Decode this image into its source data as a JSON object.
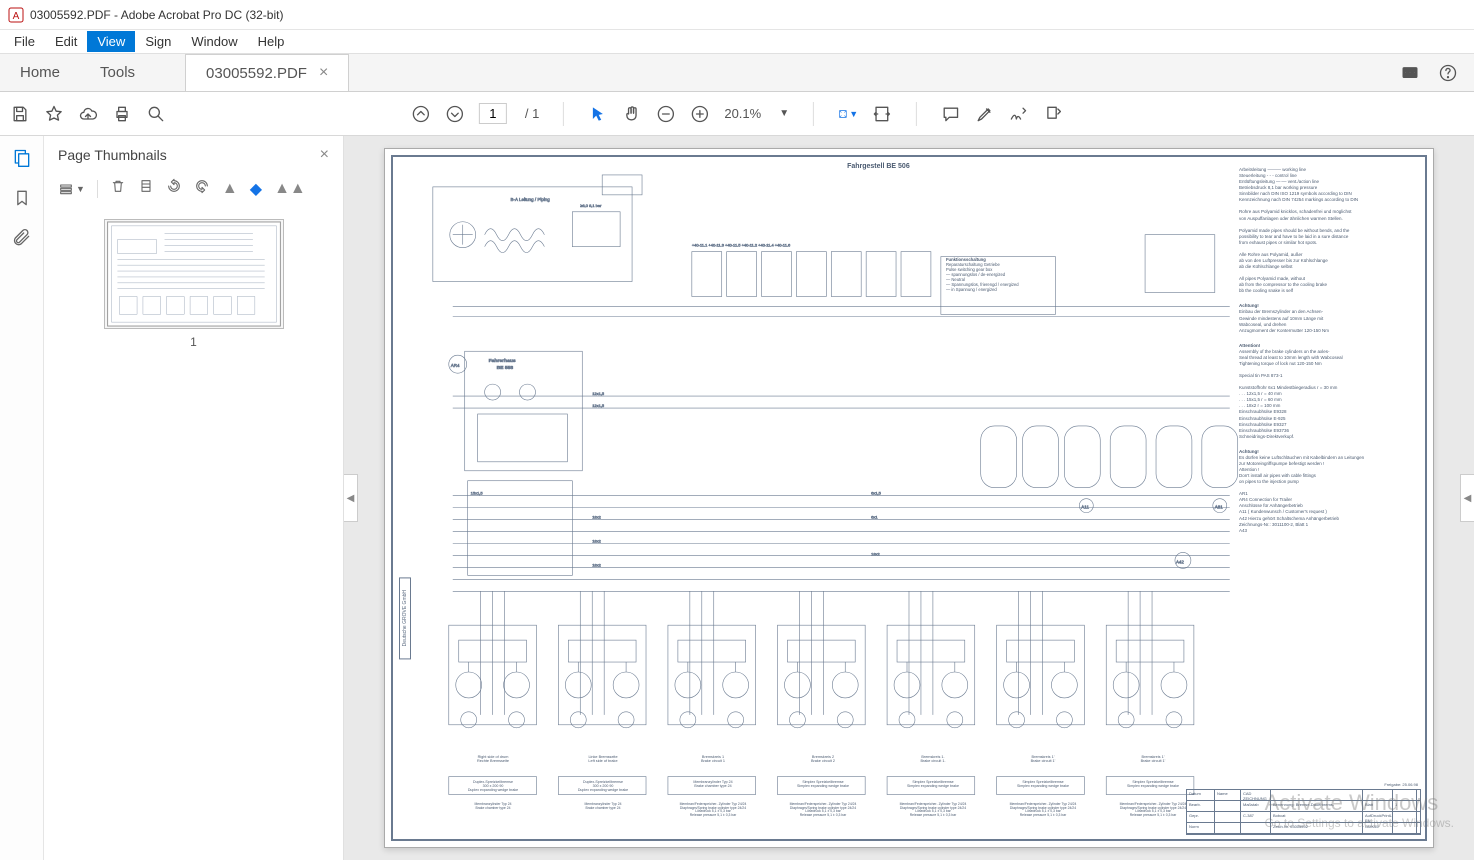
{
  "window": {
    "title": "03005592.PDF - Adobe Acrobat Pro DC (32-bit)"
  },
  "menubar": {
    "items": [
      "File",
      "Edit",
      "View",
      "Sign",
      "Window",
      "Help"
    ],
    "active_index": 2
  },
  "tabbar": {
    "home": "Home",
    "tools": "Tools",
    "doc": "03005592.PDF"
  },
  "toolbar": {
    "page_current": "1",
    "page_total": "/ 1",
    "zoom": "20.1%"
  },
  "thumbnails": {
    "title": "Page Thumbnails",
    "items": [
      {
        "label": "1"
      }
    ]
  },
  "schematic": {
    "title": "Fahrgestell BE 506",
    "subtitle1": "Fahrerhaus",
    "subtitle2": "BE 558",
    "func_box": "Funktionsschaltung",
    "func_lines": [
      "Reparaturschaltung Getriebe",
      "Pulse switching gear box",
      "—  spannungslos / de-energized",
      "—  Neutral",
      "—  Spannungslos, frierengd / energized",
      "—  in Spannung / energized"
    ],
    "notes": [
      "Arbeitsleitung ——— working line",
      "Steuerleitung - - -  control line",
      "Entlüftungsleitung —·— vent./action line",
      "Betriebsdruck    8,1 bar   working pressure",
      "Sinnbilder nach DIN ISO 1219  symbols according to DIN",
      "Kennzeichnung nach DIN 74254  markings according to DIN",
      "",
      "Rohre aus Polyamid knicklos, schadenfrei und möglichst",
      "von Auspuffanlagen oder ähnlichen warmen Stellen.",
      "",
      "Polyamid made pipes should be without bends, and the",
      "possibility to tear and have to be laid in a sure distance",
      "from exhaust pipes or similar hot spots.",
      "",
      "Alle Rohre aus Polyamid, außer",
      "ab von den Luftpresser bis zur Kühlschlange",
      "ab die Kühlschlange selbst",
      "",
      "All pipes Polyamid made, without",
      "ab from the compressor to the cooling brake",
      "bb the cooling snake is self",
      "",
      "Achtung!",
      "Einbau der Bremszylinder an den Achsen-",
      "Gewinde mindestens auf 10mm Länge mit",
      "Wabcoseal, und drehen",
      "Anzugmoment der Kontermutter 120-150 Nm",
      "",
      "Attention!",
      "Assembly of the brake cylinders on the axles-",
      "Seal thread at least to 10mm length with Wabcoseal",
      "Tightening torque of lock nut 120-150 Nm",
      "",
      "Special tin PAS 873-1",
      "",
      "Kunststoffrohr 6x1 Mindestbiegeradius r = 30 mm",
      "  . . .  12x1,5           r = 40 mm",
      "  . . .  15x1,5           r = 60 mm",
      "  . . .  18x2             r = 100 mm",
      "Einschraubhülse  E9328",
      "Einschraubhülse  E-925",
      "Einschraubhülse  E9327",
      "Einschraubhülse  E93736",
      "Schneidrings-Direktverkupf.",
      "",
      "Achtung!",
      "Es dürfen keine Luftschläuchen mit Kabelbindern an Leitungen",
      "zur Motoreingriffspumpe befestigt werden !",
      "Attention !",
      "Don't install air pipes with cable fittings",
      "on pipes to the injection pump",
      "",
      "AR1",
      "AR4  Connection for Trailer",
      "     Anschlüsse für Anhängerbetrieb",
      "A11  ( Kundenwunsch / Customer's request )",
      "A42  Hierzu gehört Schaltschema Anhängerbetrieb",
      "     Zeichnungs-Nr.:  3011100-2, Blatt 1",
      "A43"
    ],
    "bottom_labels": [
      {
        "top": "Right side of drum",
        "bot": "Rechte Bremsseite"
      },
      {
        "top": "Linke Bremsseite",
        "bot": "Left side of brake"
      },
      {
        "top": "Bremskreis 1",
        "bot": "Brake circuit 1"
      },
      {
        "top": "Bremskreis 2",
        "bot": "Brake circuit 2"
      },
      {
        "top": "Bremskreis 1.",
        "bot": "Brake circuit 1."
      },
      {
        "top": "Bremskreis 1'",
        "bot": "Brake circuit 1'"
      },
      {
        "top": "Bremskreis 1'",
        "bot": "Brake circuit 1'"
      }
    ],
    "wedge_labels": [
      "Duplex-Spreizkeilbremse\n300 x 200 90\nDuplex expanding wedge brake",
      "Duplex-Spreizkeilbremse\n300 x 200 90\nDuplex expanding wedge brake",
      "Membranzylinder Typ 24\nBrake chamber type 24",
      "Simplex Spreizkeilbremse\nSimplex expanding wedge brake",
      "Simplex Spreizkeilbremse\nSimplex expanding wedge brake",
      "Simplex Spreizkeilbremse\nSimplex expanding wedge brake",
      "Simplex Spreizkeilbremse\nSimplex expanding wedge brake"
    ],
    "cylinder_labels": [
      "Membranzylinder Typ 24\nBrake chamber type 24",
      "Membranzylinder Typ 24\nBrake chamber type 24",
      "Membran/Federspeicher- Zylinder Typ 24/24\nDiaphragm/Spring brake cylinder type 24/24\nLösedruck 5,1 ± 0,3 bar\nRelease pressure 5,1 ± 0,3 bar",
      "Membran/Federspeicher- Zylinder Typ 24/24\nDiaphragm/Spring brake cylinder type 24/24\nLösedruck 5,1 ± 0,3 bar\nRelease pressure 5,1 ± 0,3 bar",
      "Membran/Federspeicher- Zylinder Typ 24/24\nDiaphragm/Spring brake cylinder type 24/24\nLösedruck 5,1 ± 0,3 bar\nRelease pressure 5,1 ± 0,3 bar",
      "Membran/Federspeicher- Zylinder Typ 24/24\nDiaphragm/Spring brake cylinder type 24/24\nLösedruck 5,1 ± 0,3 bar\nRelease pressure 5,1 ± 0,3 bar",
      "Membran/Federspeicher- Zylinder Typ 24/24\nDiaphragm/Spring brake cylinder type 24/24\nLösedruck 5,1 ± 0,3 bar\nRelease pressure 5,1 ± 0,3 bar"
    ],
    "vertical_label": "Deutsche GROVE GmbH",
    "titleblock": {
      "rows": [
        [
          "Datum",
          "Name",
          "CAD ZEICHNUNG",
          "",
          "",
          ""
        ],
        [
          "Bearb.",
          "",
          "Maßstab",
          "Benennung: Bremse-Dauerbrems-",
          "Blatt",
          "1"
        ],
        [
          "Gepr.",
          "",
          "C-387",
          "Bobcat",
          "AufDruckPrintLage: EN",
          ""
        ],
        [
          "Norm",
          "",
          "",
          "Zeich.Nr. 03005592",
          "GMK55",
          ""
        ]
      ],
      "freigabe": "Freigabe: 25.06.98"
    },
    "wire_tags": [
      "18x2",
      "15x1,5",
      "12x1,5",
      "6x1",
      "+40 2x23",
      "+41 1x3",
      "A12",
      "A11",
      "A81",
      "AR4"
    ],
    "pressure": "≥8,0 8,1 bar",
    "piping": "B-A Leitung\nPiping"
  },
  "watermark": {
    "main": "Activate Windows",
    "sub": "Go to Settings to activate Windows."
  }
}
